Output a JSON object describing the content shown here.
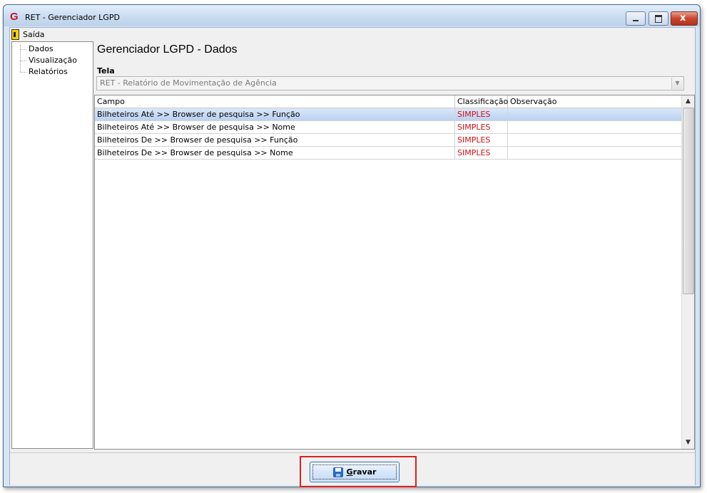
{
  "window": {
    "title": "RET - Gerenciador LGPD",
    "app_logo": "G",
    "buttons": {
      "minimize_icon": "minimize-icon",
      "maximize_icon": "maximize-icon",
      "close_icon": "close-icon",
      "close_glyph": "x"
    }
  },
  "menu": {
    "exit_label": "Saída",
    "exit_icon": "exit-door-icon"
  },
  "tree": {
    "items": [
      "Dados",
      "Visualização",
      "Relatórios"
    ]
  },
  "main": {
    "title": "Gerenciador LGPD - Dados",
    "tela_label": "Tela",
    "tela_value": "RET - Relatório de Movimentação de Agência"
  },
  "grid": {
    "columns": [
      "Campo",
      "Classificação",
      "Observação"
    ],
    "rows": [
      {
        "campo": "Bilheteiros Até >> Browser de pesquisa >> Função",
        "classificacao": "SIMPLES",
        "observacao": ""
      },
      {
        "campo": "Bilheteiros Até >> Browser de pesquisa >> Nome",
        "classificacao": "SIMPLES",
        "observacao": ""
      },
      {
        "campo": "Bilheteiros De >> Browser de pesquisa >> Função",
        "classificacao": "SIMPLES",
        "observacao": ""
      },
      {
        "campo": "Bilheteiros De >> Browser de pesquisa >> Nome",
        "classificacao": "SIMPLES",
        "observacao": ""
      }
    ],
    "selected_row": 0
  },
  "footer": {
    "save_label": "Gravar",
    "save_icon": "floppy-disk-icon"
  },
  "colors": {
    "classification_text": "#d41010",
    "highlight_border": "#e02020",
    "selection": "#b9d1f1"
  }
}
